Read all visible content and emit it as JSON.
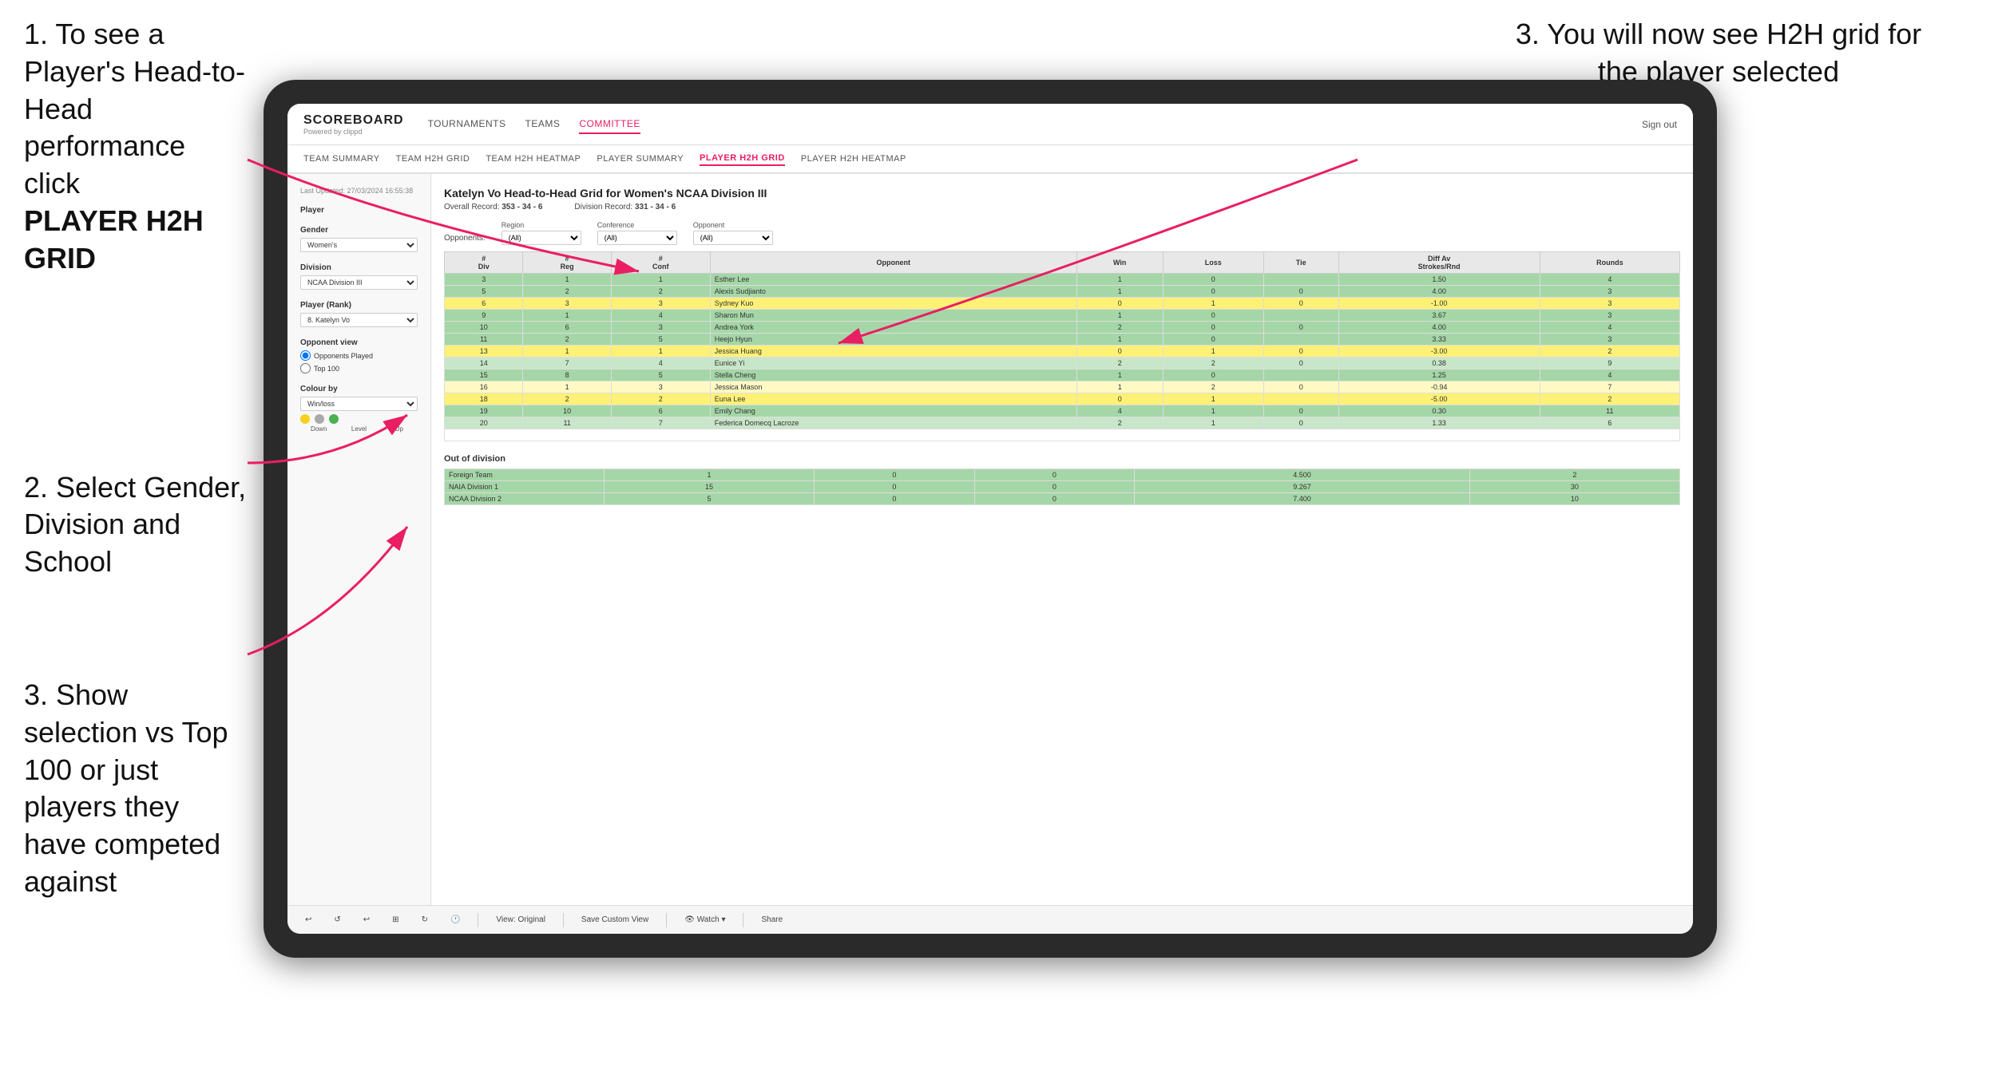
{
  "instructions": {
    "step1": "1. To see a Player's Head-to-Head performance click",
    "step1_bold": "PLAYER H2H GRID",
    "step2": "2. Select Gender, Division and School",
    "step3_left": "3. Show selection vs Top 100 or just players they have competed against",
    "step3_right": "3. You will now see H2H grid for the player selected"
  },
  "nav": {
    "logo": "SCOREBOARD",
    "logo_sub": "Powered by clippd",
    "links": [
      "TOURNAMENTS",
      "TEAMS",
      "COMMITTEE",
      "Sign out"
    ],
    "sub_links": [
      "TEAM SUMMARY",
      "TEAM H2H GRID",
      "TEAM H2H HEATMAP",
      "PLAYER SUMMARY",
      "PLAYER H2H GRID",
      "PLAYER H2H HEATMAP"
    ]
  },
  "sidebar": {
    "timestamp": "Last Updated: 27/03/2024 16:55:38",
    "player_label": "Player",
    "gender_label": "Gender",
    "gender_value": "Women's",
    "division_label": "Division",
    "division_value": "NCAA Division III",
    "player_rank_label": "Player (Rank)",
    "player_rank_value": "8. Katelyn Vo",
    "opponent_view_label": "Opponent view",
    "opponent_options": [
      "Opponents Played",
      "Top 100"
    ],
    "colour_by_label": "Colour by",
    "colour_by_value": "Win/loss",
    "legend_down": "Down",
    "legend_level": "Level",
    "legend_up": "Up"
  },
  "grid": {
    "title": "Katelyn Vo Head-to-Head Grid for Women's NCAA Division III",
    "overall_record_label": "Overall Record:",
    "overall_record": "353 - 34 - 6",
    "division_record_label": "Division Record:",
    "division_record": "331 - 34 - 6",
    "region_label": "Region",
    "conference_label": "Conference",
    "opponent_label": "Opponent",
    "opponents_label": "Opponents:",
    "all_label": "(All)",
    "col_headers": [
      "# Div",
      "# Reg",
      "# Conf",
      "Opponent",
      "Win",
      "Loss",
      "Tie",
      "Diff Av Strokes/Rnd",
      "Rounds"
    ],
    "rows": [
      {
        "div": "3",
        "reg": "1",
        "conf": "1",
        "opponent": "Esther Lee",
        "win": "1",
        "loss": "0",
        "tie": "",
        "diff": "1.50",
        "rounds": "4",
        "color": "green"
      },
      {
        "div": "5",
        "reg": "2",
        "conf": "2",
        "opponent": "Alexis Sudjianto",
        "win": "1",
        "loss": "0",
        "tie": "0",
        "diff": "4.00",
        "rounds": "3",
        "color": "green"
      },
      {
        "div": "6",
        "reg": "3",
        "conf": "3",
        "opponent": "Sydney Kuo",
        "win": "0",
        "loss": "1",
        "tie": "0",
        "diff": "-1.00",
        "rounds": "3",
        "color": "yellow"
      },
      {
        "div": "9",
        "reg": "1",
        "conf": "4",
        "opponent": "Sharon Mun",
        "win": "1",
        "loss": "0",
        "tie": "",
        "diff": "3.67",
        "rounds": "3",
        "color": "green"
      },
      {
        "div": "10",
        "reg": "6",
        "conf": "3",
        "opponent": "Andrea York",
        "win": "2",
        "loss": "0",
        "tie": "0",
        "diff": "4.00",
        "rounds": "4",
        "color": "green"
      },
      {
        "div": "11",
        "reg": "2",
        "conf": "5",
        "opponent": "Heejo Hyun",
        "win": "1",
        "loss": "0",
        "tie": "",
        "diff": "3.33",
        "rounds": "3",
        "color": "green"
      },
      {
        "div": "13",
        "reg": "1",
        "conf": "1",
        "opponent": "Jessica Huang",
        "win": "0",
        "loss": "1",
        "tie": "0",
        "diff": "-3.00",
        "rounds": "2",
        "color": "yellow"
      },
      {
        "div": "14",
        "reg": "7",
        "conf": "4",
        "opponent": "Eunice Yi",
        "win": "2",
        "loss": "2",
        "tie": "0",
        "diff": "0.38",
        "rounds": "9",
        "color": "light-green"
      },
      {
        "div": "15",
        "reg": "8",
        "conf": "5",
        "opponent": "Stella Cheng",
        "win": "1",
        "loss": "0",
        "tie": "",
        "diff": "1.25",
        "rounds": "4",
        "color": "green"
      },
      {
        "div": "16",
        "reg": "1",
        "conf": "3",
        "opponent": "Jessica Mason",
        "win": "1",
        "loss": "2",
        "tie": "0",
        "diff": "-0.94",
        "rounds": "7",
        "color": "light-yellow"
      },
      {
        "div": "18",
        "reg": "2",
        "conf": "2",
        "opponent": "Euna Lee",
        "win": "0",
        "loss": "1",
        "tie": "",
        "diff": "-5.00",
        "rounds": "2",
        "color": "yellow"
      },
      {
        "div": "19",
        "reg": "10",
        "conf": "6",
        "opponent": "Emily Chang",
        "win": "4",
        "loss": "1",
        "tie": "0",
        "diff": "0.30",
        "rounds": "11",
        "color": "green"
      },
      {
        "div": "20",
        "reg": "11",
        "conf": "7",
        "opponent": "Federica Domecq Lacroze",
        "win": "2",
        "loss": "1",
        "tie": "0",
        "diff": "1.33",
        "rounds": "6",
        "color": "light-green"
      }
    ],
    "out_of_division_title": "Out of division",
    "out_rows": [
      {
        "name": "Foreign Team",
        "win": "1",
        "loss": "0",
        "tie": "0",
        "diff": "4.500",
        "rounds": "2",
        "color": "green"
      },
      {
        "name": "NAIA Division 1",
        "win": "15",
        "loss": "0",
        "tie": "0",
        "diff": "9.267",
        "rounds": "30",
        "color": "green"
      },
      {
        "name": "NCAA Division 2",
        "win": "5",
        "loss": "0",
        "tie": "0",
        "diff": "7.400",
        "rounds": "10",
        "color": "green"
      }
    ]
  },
  "toolbar": {
    "view_original": "View: Original",
    "save_custom_view": "Save Custom View",
    "watch": "Watch",
    "share": "Share"
  }
}
